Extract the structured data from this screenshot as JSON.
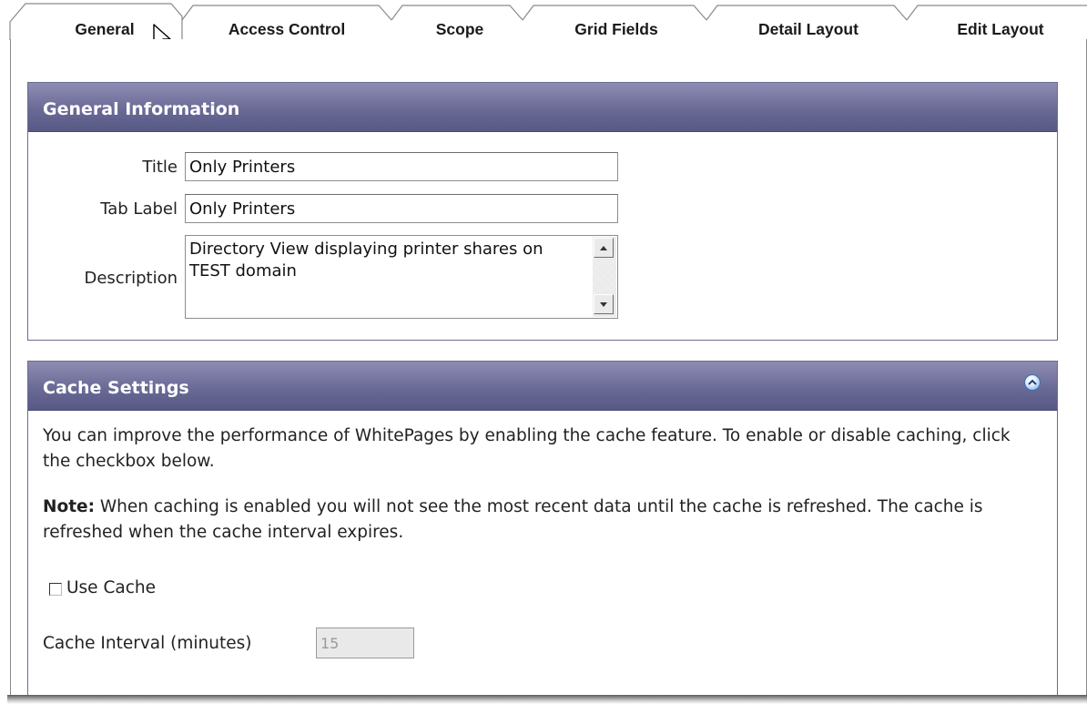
{
  "tabs": [
    {
      "label": "General",
      "active": true
    },
    {
      "label": "Access Control",
      "active": false
    },
    {
      "label": "Scope",
      "active": false
    },
    {
      "label": "Grid Fields",
      "active": false
    },
    {
      "label": "Detail Layout",
      "active": false
    },
    {
      "label": "Edit Layout",
      "active": false
    }
  ],
  "general": {
    "header": "General Information",
    "title_label": "Title",
    "title_value": "Only Printers",
    "tab_label_label": "Tab Label",
    "tab_label_value": "Only Printers",
    "description_label": "Description",
    "description_value": "Directory View displaying printer shares on TEST domain"
  },
  "cache": {
    "header": "Cache Settings",
    "intro": "You can improve the performance of WhitePages by enabling the cache feature. To enable or disable caching, click the checkbox below.",
    "note_label": "Note:",
    "note_text": " When caching is enabled you will not see the most recent data until the cache is refreshed. The cache is refreshed when the cache interval expires.",
    "use_cache_label": "Use Cache",
    "use_cache_checked": false,
    "interval_label": "Cache Interval (minutes)",
    "interval_value": "15"
  },
  "colors": {
    "header_top": "#8d8db3",
    "header_bottom": "#585885",
    "section_border": "#6b6b95"
  }
}
